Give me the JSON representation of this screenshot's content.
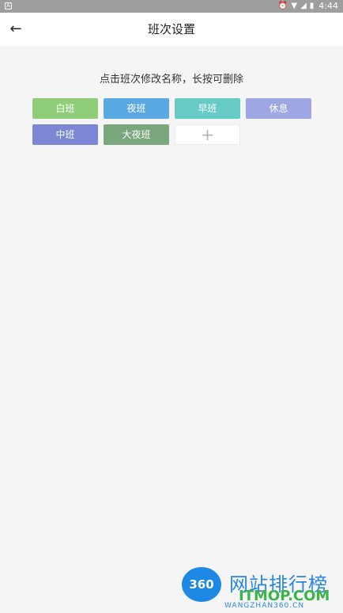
{
  "status_bar": {
    "time": "4:44",
    "icons": [
      "alarm-icon",
      "wifi-icon",
      "signal-icon",
      "battery-icon"
    ]
  },
  "app_bar": {
    "back_icon": "back-arrow-icon",
    "title": "班次设置"
  },
  "hint": "点击班次修改名称，长按可删除",
  "shifts": [
    {
      "label": "白班",
      "color": "#8fcd78"
    },
    {
      "label": "夜班",
      "color": "#5aa9e2"
    },
    {
      "label": "早班",
      "color": "#66cbc4"
    },
    {
      "label": "休息",
      "color": "#9ea6e4"
    },
    {
      "label": "中班",
      "color": "#7b87d4"
    },
    {
      "label": "大夜班",
      "color": "#7aa87c"
    }
  ],
  "add_button": {
    "icon": "plus-icon",
    "glyph": "+"
  },
  "watermark": {
    "logo_text": "360",
    "cn_text": "网站排行榜",
    "en_text": "ITMOP.COM",
    "url_text": "WANGZHAN360.CN"
  }
}
